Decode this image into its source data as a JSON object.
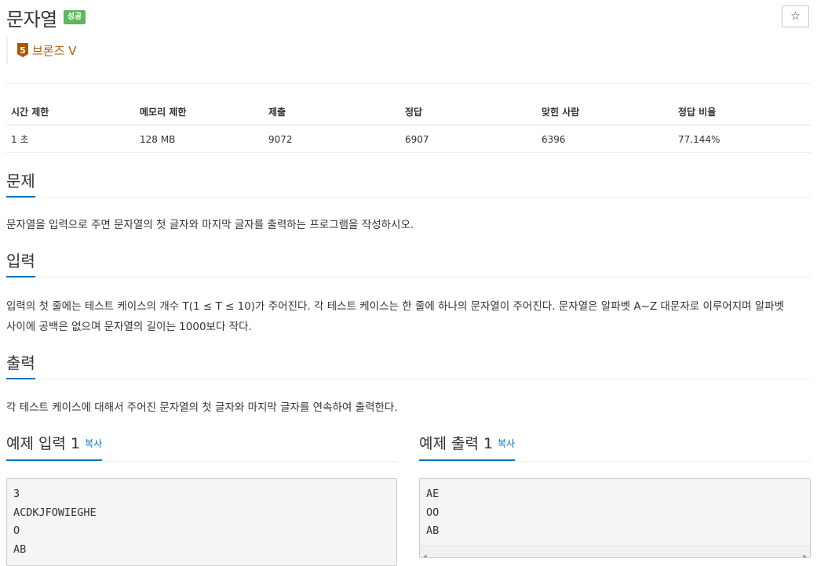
{
  "problem": {
    "title": "문자열",
    "status_badge": "성공",
    "star_icon": "☆",
    "tier_number": "5",
    "tier_label": "브론즈 V"
  },
  "info_table": {
    "headers": [
      "시간 제한",
      "메모리 제한",
      "제출",
      "정답",
      "맞힌 사람",
      "정답 비율"
    ],
    "values": [
      "1 초",
      "128 MB",
      "9072",
      "6907",
      "6396",
      "77.144%"
    ]
  },
  "sections": {
    "description": {
      "title": "문제",
      "text": "문자열을 입력으로 주면 문자열의 첫 글자와 마지막 글자를 출력하는 프로그램을 작성하시오."
    },
    "input": {
      "title": "입력",
      "line1": "입력의 첫 줄에는 테스트 케이스의 개수 T(1 ≤ T ≤ 10)가 주어진다. 각 테스트 케이스는 한 줄에 하나의 문자열이 주어진다. 문자열은 알파벳 A~Z 대문자로 이루어지며 알파벳",
      "line2": "사이에 공백은 없으며 문자열의 길이는 1000보다 작다."
    },
    "output": {
      "title": "출력",
      "text": "각 테스트 케이스에 대해서 주어진 문자열의 첫 글자와 마지막 글자를 연속하여 출력한다."
    }
  },
  "samples": {
    "input": {
      "title": "예제 입력 1",
      "copy": "복사",
      "lines": [
        "3",
        "ACDKJFOWIEGHE",
        "O",
        "AB"
      ]
    },
    "output": {
      "title": "예제 출력 1",
      "copy": "복사",
      "lines": [
        "AE",
        "OO",
        "AB"
      ]
    }
  },
  "colors": {
    "accent": "#0076c0",
    "success": "#5cb85c",
    "bronze": "#ad5600"
  }
}
